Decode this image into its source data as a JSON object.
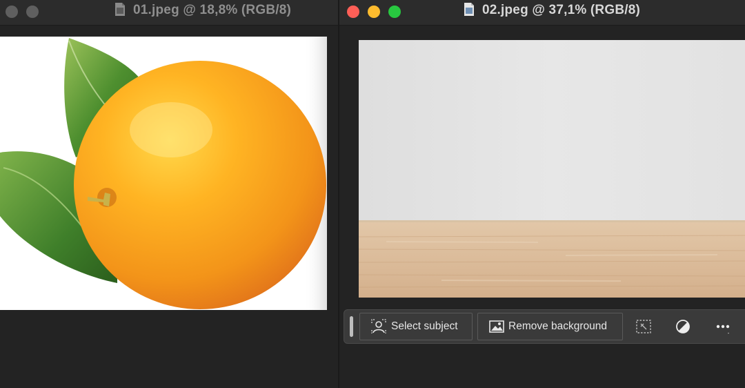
{
  "window1": {
    "title": "01.jpeg @ 18,8% (RGB/8)",
    "controls": {
      "close": "#5f5f5f",
      "minimize": "#5f5f5f",
      "zoom": "#5f5f5f"
    }
  },
  "window2": {
    "title": "02.jpeg @ 37,1% (RGB/8)",
    "controls": {
      "close": "#ff5f57",
      "minimize": "#febc2e",
      "zoom": "#28c840"
    }
  },
  "taskbar": {
    "select_subject_label": "Select subject",
    "remove_background_label": "Remove background",
    "icons": [
      "select-subject-icon",
      "remove-background-icon",
      "transform-selection-icon",
      "adjustment-icon",
      "more-icon"
    ]
  }
}
